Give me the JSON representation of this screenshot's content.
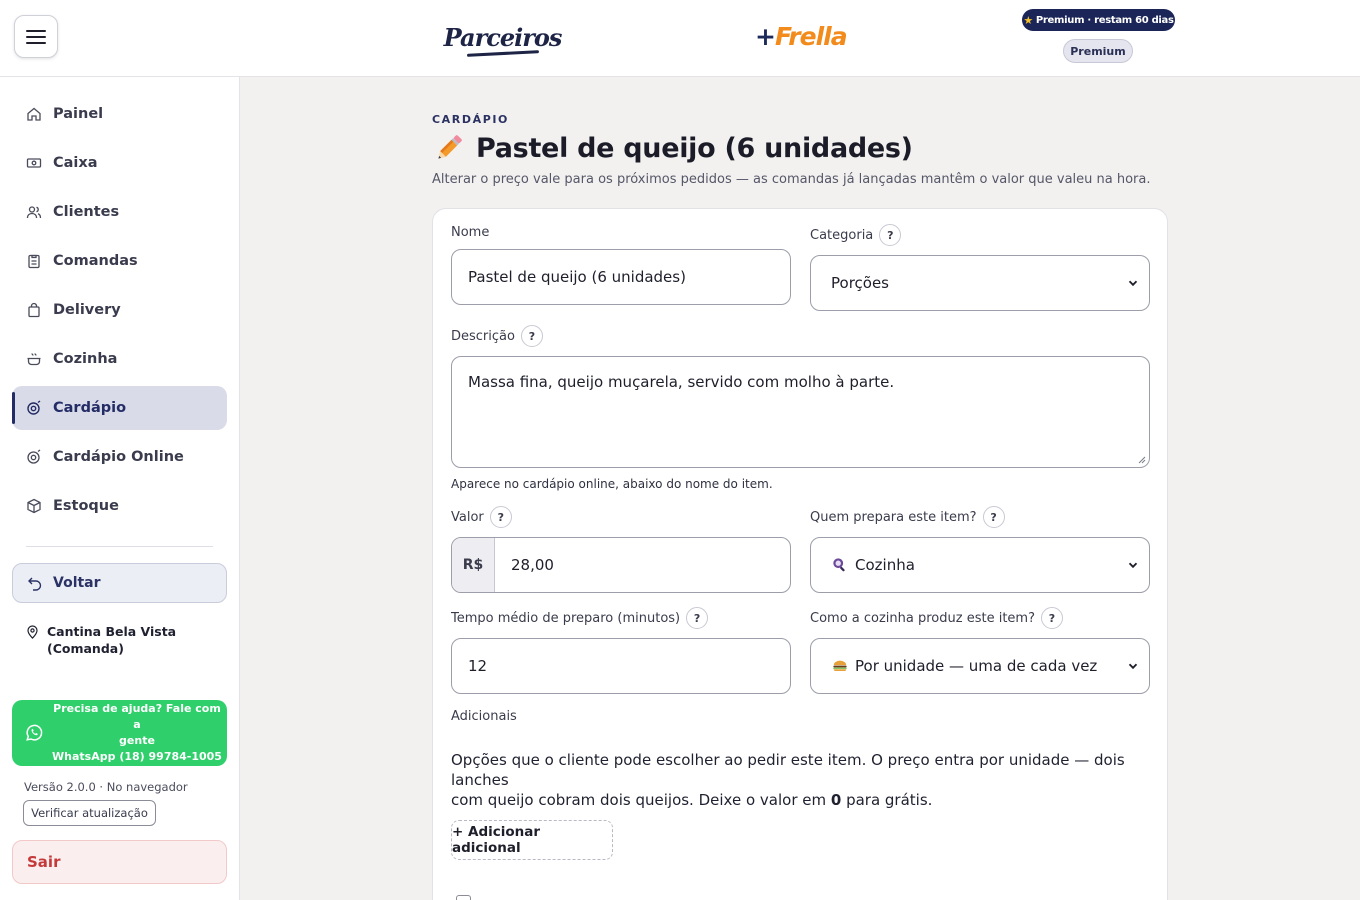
{
  "header": {
    "brand_left": "Parceiros",
    "brand_right_plus": "+",
    "brand_right": "Frella",
    "premium_pill": "Premium · restam 60 dias",
    "premium_badge": "Premium"
  },
  "sidebar": {
    "items": [
      {
        "label": "Painel",
        "icon": "home-icon"
      },
      {
        "label": "Caixa",
        "icon": "cash-icon"
      },
      {
        "label": "Clientes",
        "icon": "users-icon"
      },
      {
        "label": "Comandas",
        "icon": "clipboard-icon"
      },
      {
        "label": "Delivery",
        "icon": "bag-icon"
      },
      {
        "label": "Cozinha",
        "icon": "cooking-pot-icon"
      },
      {
        "label": "Cardápio",
        "icon": "menu-book-icon",
        "active": true
      },
      {
        "label": "Cardápio Online",
        "icon": "menu-online-icon"
      },
      {
        "label": "Estoque",
        "icon": "box-icon"
      }
    ],
    "back_label": "Voltar",
    "location_line1": "Cantina Bela Vista",
    "location_line2": "(Comanda)",
    "help_line1": "Precisa de ajuda? Fale com a",
    "help_line2": "gente",
    "help_line3": "WhatsApp (18) 99784-1005",
    "version": "Versão 2.0.0 · No navegador",
    "update_label": "Verificar atualização",
    "logout_label": "Sair"
  },
  "page": {
    "eyebrow": "CARDÁPIO",
    "title": "Pastel de queijo (6 unidades)",
    "subtitle": "Alterar o preço vale para os próximos pedidos — as comandas já lançadas mantêm o valor que valeu na hora."
  },
  "form": {
    "name_label": "Nome",
    "name_value": "Pastel de queijo (6 unidades)",
    "category_label": "Categoria",
    "category_value": "Porções",
    "description_label": "Descrição",
    "description_value": "Massa fina, queijo muçarela, servido com molho à parte.",
    "description_hint": "Aparece no cardápio online, abaixo do nome do item.",
    "price_label": "Valor",
    "currency": "R$",
    "price_value": "28,00",
    "preparer_label": "Quem prepara este item?",
    "preparer_value": "Cozinha",
    "prep_time_label": "Tempo médio de preparo (minutos)",
    "prep_time_value": "12",
    "production_label": "Como a cozinha produz este item?",
    "production_value": "Por unidade — uma de cada vez",
    "help_mark": "?",
    "addons_label": "Adicionais",
    "addons_text_1": "Opções que o cliente pode escolher ao pedir este item. O preço entra por unidade — dois lanches",
    "addons_text_2a": "com queijo cobram dois queijos. Deixe o valor em ",
    "addons_text_2b": "0",
    "addons_text_2c": " para grátis.",
    "add_addon_label": "+ Adicionar adicional"
  }
}
